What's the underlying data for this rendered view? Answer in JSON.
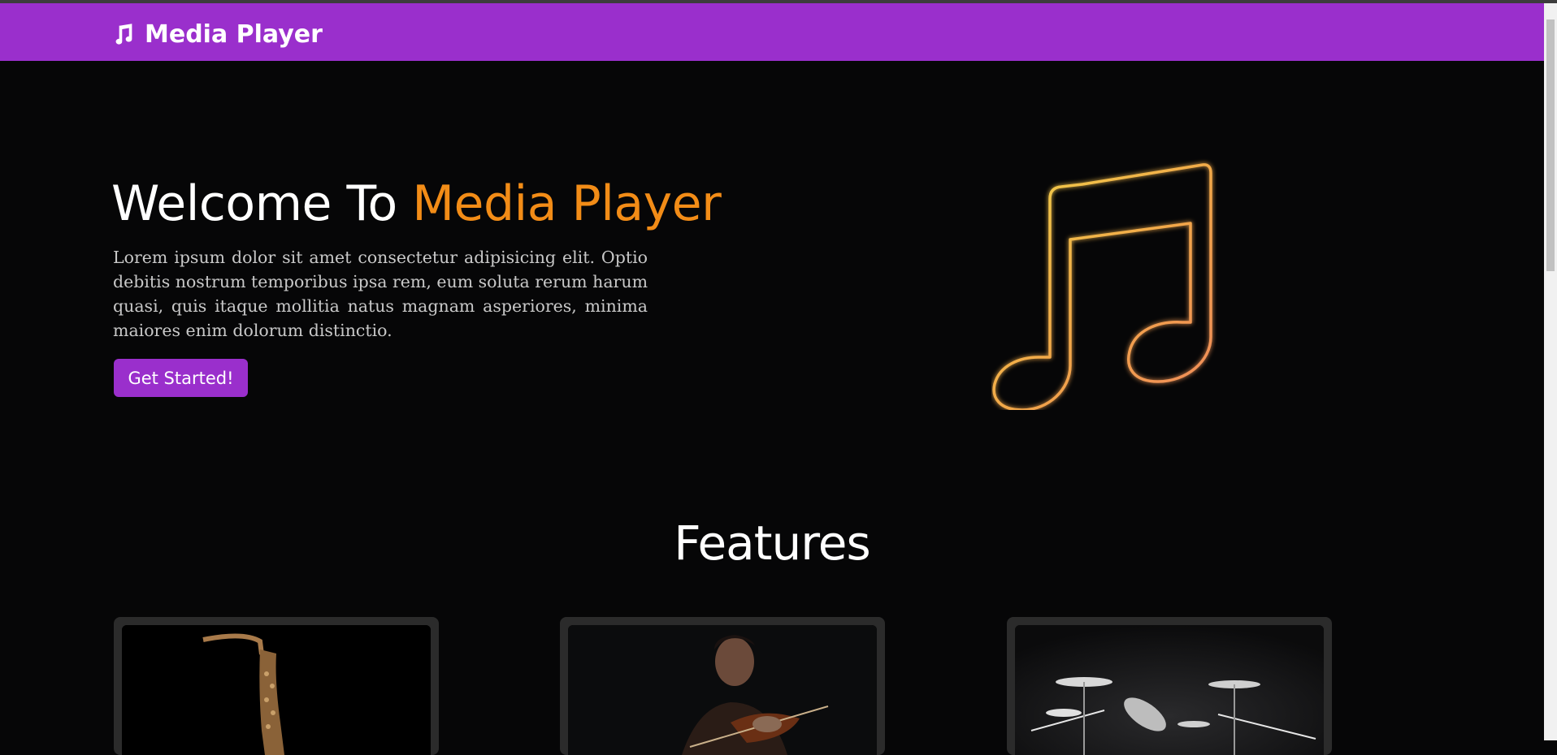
{
  "navbar": {
    "brand_name": "Media Player",
    "brand_icon": "music-note-icon",
    "background_color": "#9a2fcc"
  },
  "hero": {
    "title_prefix": "Welcome To ",
    "title_accent": "Media Player",
    "accent_color": "#f28c17",
    "description": "Lorem ipsum dolor sit amet consectetur adipisicing elit. Optio debitis nostrum temporibus ipsa rem, eum soluta rerum harum quasi, quis itaque mollitia natus magnam asperiores, minima maiores enim dolorum distinctio.",
    "cta_label": "Get Started!",
    "illustration": "neon-music-note"
  },
  "features": {
    "title": "Features",
    "cards": [
      {
        "image": "saxophone-photo"
      },
      {
        "image": "violinist-photo"
      },
      {
        "image": "drum-kit-photo"
      }
    ]
  }
}
